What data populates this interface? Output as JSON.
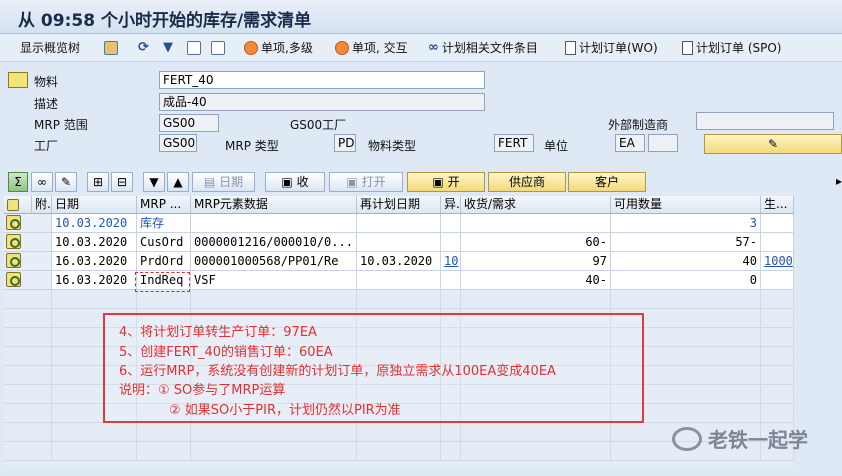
{
  "window": {
    "title": "从 09:58 个小时开始的库存/需求清单"
  },
  "toolbar": {
    "show_overview_tree": "显示概览树",
    "single_multi": "单项,多级",
    "single_interactive": "单项, 交互",
    "plan_related_files": "计划相关文件条目",
    "planned_order_wo": "计划订单(WO)",
    "planned_order_spo": "计划订单 (SPO)"
  },
  "header": {
    "material_label": "物料",
    "material_value": "FERT_40",
    "desc_label": "描述",
    "desc_value": "成品-40",
    "mrp_area_label": "MRP 范围",
    "mrp_area_value": "GS00",
    "mrp_area_plant_label": "GS00工厂",
    "external_manu_label": "外部制造商",
    "external_manu_value": "",
    "plant_label": "工厂",
    "plant_value": "GS00",
    "mrp_type_label": "MRP 类型",
    "mrp_type_value": "PD",
    "material_type_label": "物料类型",
    "material_type_value": "FERT",
    "unit_label": "单位",
    "unit_value": "EA",
    "unit_extra": ""
  },
  "row_toolbar": {
    "date_btn": "日期",
    "collect_btn": "收",
    "open_btn": "打开",
    "open2_btn": "开",
    "vendor_btn": "供应商",
    "customer_btn": "客户"
  },
  "grid": {
    "headers": [
      "附.",
      "日期",
      "MRP ...",
      "MRP元素数据",
      "再计划日期",
      "异.",
      "收货/需求",
      "可用数量",
      "生..."
    ],
    "rows": [
      {
        "date": "10.03.2020",
        "element": "库存",
        "data": "",
        "replan": "",
        "exc": "",
        "qty": "",
        "avail": "3",
        "prod": ""
      },
      {
        "date": "10.03.2020",
        "element": "CusOrd",
        "data": "0000001216/000010/0...",
        "replan": "",
        "exc": "",
        "qty": "60-",
        "avail": "57-",
        "prod": ""
      },
      {
        "date": "16.03.2020",
        "element": "PrdOrd",
        "data": "000001000568/PP01/Re",
        "replan": "10.03.2020",
        "exc": "10",
        "qty": "97",
        "avail": "40",
        "prod": "1000"
      },
      {
        "date": "16.03.2020",
        "element": "IndReq",
        "data": "VSF",
        "replan": "",
        "exc": "",
        "qty": "40-",
        "avail": "0",
        "prod": ""
      }
    ]
  },
  "annotation": {
    "line1": "4、将计划订单转生产订单：97EA",
    "line2": "5、创建FERT_40的销售订单：60EA",
    "line3": "6、运行MRP，系统没有创建新的计划订单，原独立需求从100EA变成40EA",
    "line4": "说明：① SO参与了MRP运算",
    "line5": "② 如果SO小于PIR，计划仍然以PIR为准"
  },
  "watermark": {
    "text": "老铁一起学"
  },
  "colors": {
    "annotation_red": "#e03030",
    "link_blue": "#1f55b8",
    "header_bg": "#dfe9f5"
  }
}
